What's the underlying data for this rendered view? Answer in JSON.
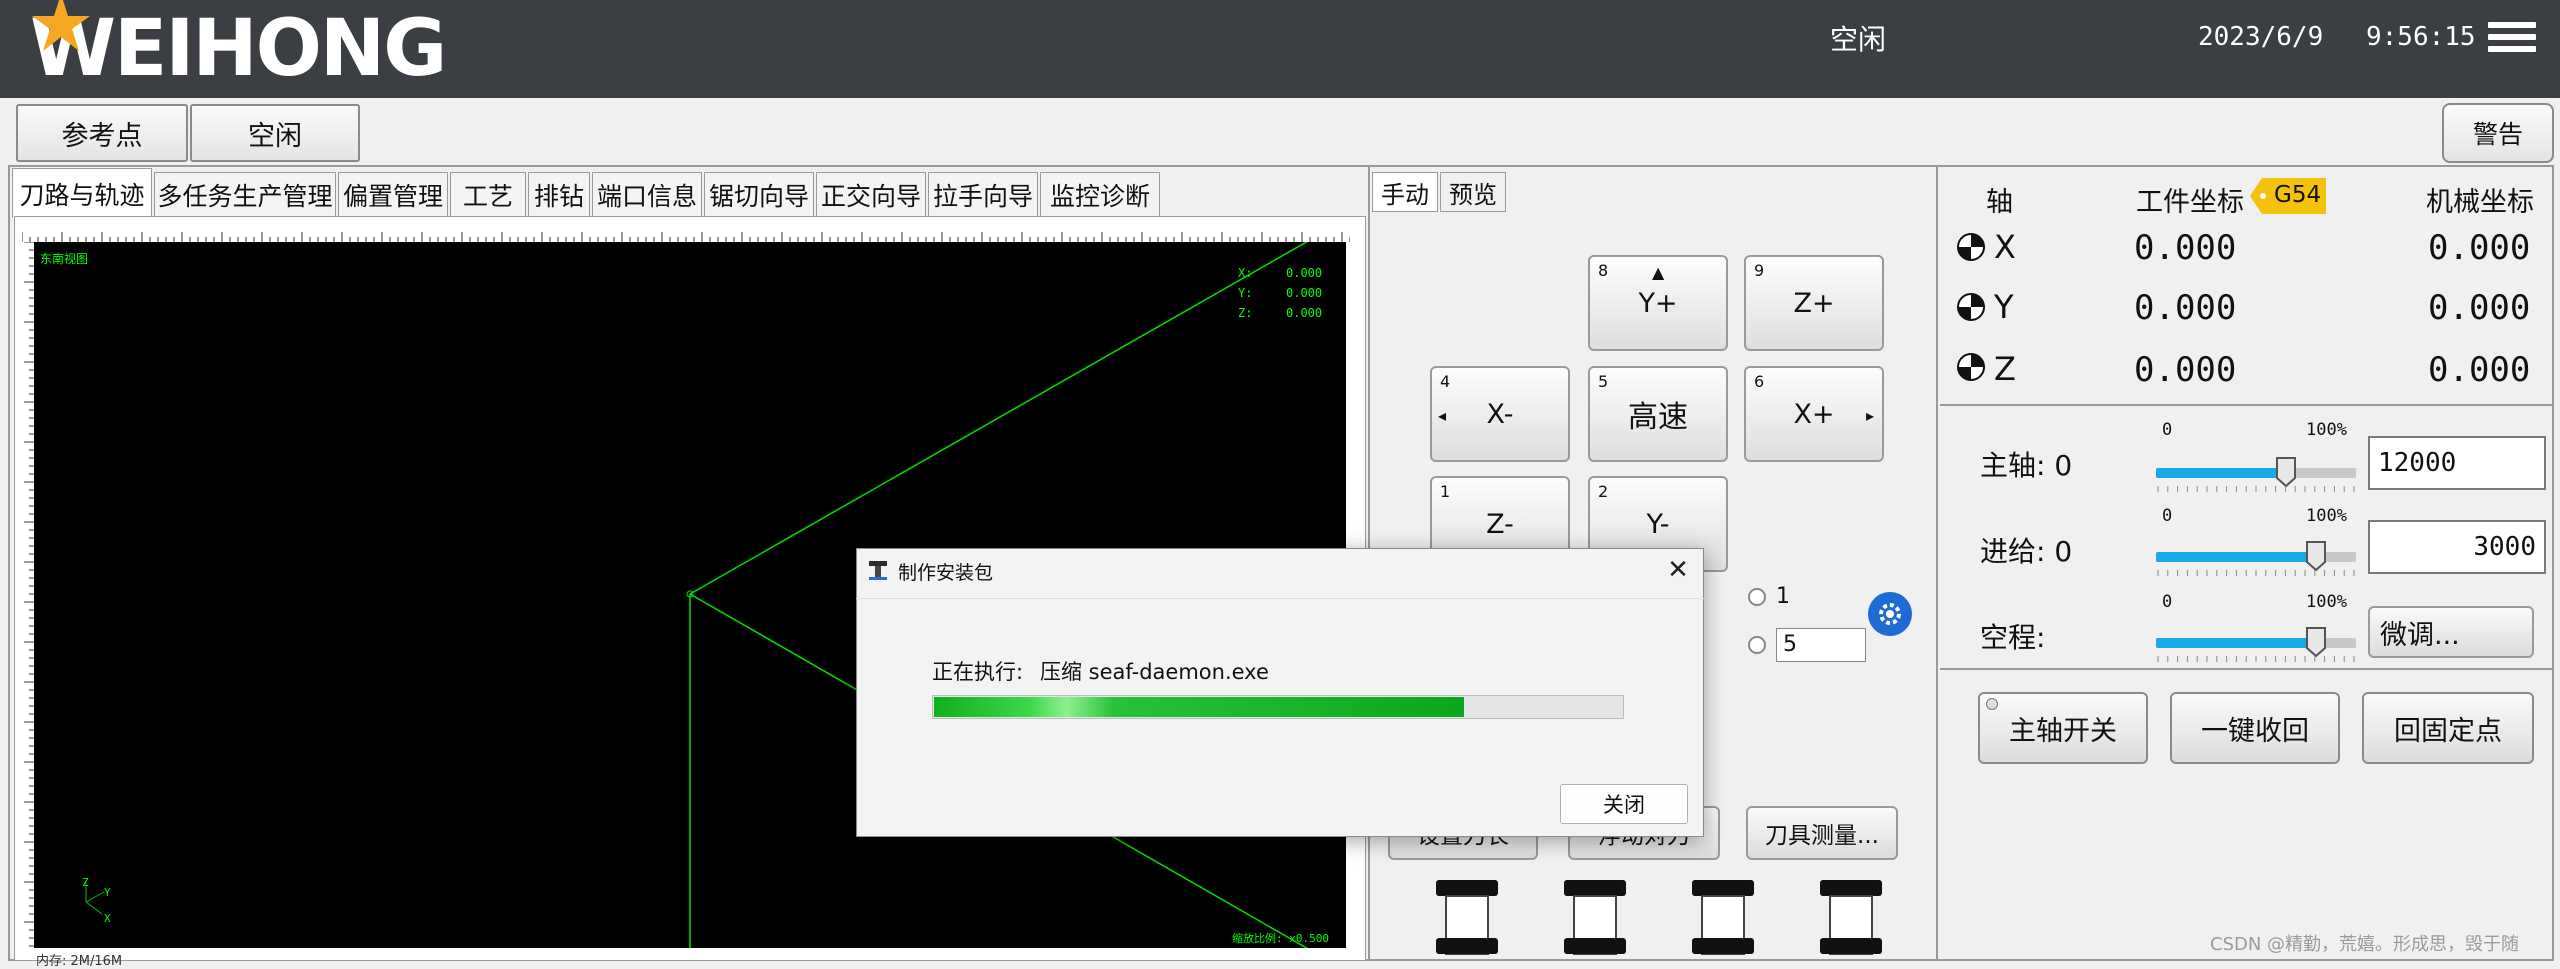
{
  "topbar": {
    "brand": "WEIHONG",
    "status": "空闲",
    "date": "2023/6/9",
    "time": "9:56:15"
  },
  "toolbar": {
    "reference_label": "参考点",
    "idle_label": "空闲",
    "warning_label": "警告"
  },
  "left_tabs": [
    "刀路与轨迹",
    "多任务生产管理",
    "偏置管理",
    "工艺",
    "排钻",
    "端口信息",
    "锯切向导",
    "正交向导",
    "拉手向导",
    "监控诊断"
  ],
  "viewport": {
    "view_name": "东南视图",
    "coord_labels": [
      "X:",
      "Y:",
      "Z:"
    ],
    "coord_values": [
      "0.000",
      "0.000",
      "0.000"
    ],
    "scale_text": "缩放比例: x0.500",
    "axis_z": "Z",
    "axis_y": "Y",
    "axis_x": "X",
    "memory": "内存: 2M/16M"
  },
  "mid_tabs": [
    "手动",
    "预览"
  ],
  "jog": {
    "y_plus": {
      "num": "8",
      "label": "Y+"
    },
    "z_plus": {
      "num": "9",
      "label": "Z+"
    },
    "x_minus": {
      "num": "4",
      "label": "X-"
    },
    "high_speed": {
      "num": "5",
      "label": "高速"
    },
    "x_plus": {
      "num": "6",
      "label": "X+"
    },
    "z_minus": {
      "num": "1",
      "label": "Z-"
    },
    "y_minus": {
      "num": "2",
      "label": "Y-"
    }
  },
  "step": {
    "radio1_label": "1",
    "input_value": "5"
  },
  "mid_buttons": {
    "set_tool_length": "设置刀长",
    "float_tool": "浮动对刀",
    "tool_measure": "刀具测量..."
  },
  "coords": {
    "axis_header": "轴",
    "work_header": "工件坐标",
    "wcs_badge": "G54",
    "machine_header": "机械坐标",
    "rows": [
      {
        "axis": "X",
        "work": "0.000",
        "machine": "0.000"
      },
      {
        "axis": "Y",
        "work": "0.000",
        "machine": "0.000"
      },
      {
        "axis": "Z",
        "work": "0.000",
        "machine": "0.000"
      }
    ]
  },
  "overrides": {
    "spindle": {
      "label": "主轴: 0",
      "min": "0",
      "max": "100%",
      "percent": 65,
      "value": "12000"
    },
    "feed": {
      "label": "进给: 0",
      "min": "0",
      "max": "100%",
      "percent": 80,
      "value": "3000"
    },
    "rapid": {
      "label": "空程:",
      "min": "0",
      "max": "100%",
      "percent": 80,
      "button": "微调..."
    }
  },
  "actions": {
    "spindle_toggle": "主轴开关",
    "one_key_retract": "一键收回",
    "return_fixed_point": "回固定点"
  },
  "dialog": {
    "title": "制作安装包",
    "status_label": "正在执行:",
    "status_value": "压缩 seaf-daemon.exe",
    "progress": 0.77,
    "close_label": "关闭"
  },
  "watermark": "CSDN @精勤，荒嬉。形成思，毁于随"
}
